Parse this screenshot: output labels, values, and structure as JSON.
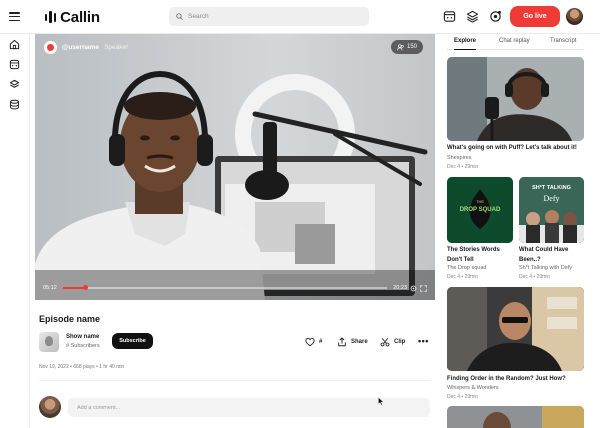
{
  "app": {
    "logo_text": "Callin"
  },
  "header": {
    "search_placeholder": "Search",
    "go_live_label": "Go live"
  },
  "video": {
    "username": "@username",
    "role": "Speaker",
    "listeners": "150",
    "current_time": "05:12",
    "total_time": "20:23",
    "progress_fraction": 0.07
  },
  "episode": {
    "title": "Episode name",
    "show_name": "Show name",
    "subscribers": "# Subscribers",
    "subscribe_label": "Subscribe",
    "likes": "#",
    "share_label": "Share",
    "clip_label": "Clip",
    "meta": "Nov 19, 2022 • 668 plays • 1 hr 40 min"
  },
  "comments": {
    "placeholder": "Add a comment..."
  },
  "sidebar": {
    "tabs": [
      {
        "label": "Explore",
        "active": true
      },
      {
        "label": "Chat replay",
        "active": false
      },
      {
        "label": "Transcript",
        "active": false
      }
    ],
    "cards": [
      {
        "title": "What's going on with Puff? Let's talk about it!",
        "show": "Shespires",
        "meta": "Dec 4 • 29min"
      },
      {
        "title": "The Stories Words Don't Tell",
        "show": "The Drop squad",
        "meta": "Dec 4 • 29min",
        "art_text_top": "THE",
        "art_text_main": "DROP SQUAD"
      },
      {
        "title": "What Could Have Been..?",
        "show": "Sh*t Talking with Defy",
        "meta": "Dec 4 • 29min",
        "art_text_top": "SH*T TALKING",
        "art_text_main": "Defy"
      },
      {
        "title": "Finding Order in the Random? Just How?",
        "show": "Whispers & Wonders",
        "meta": "Dec 4 • 29min"
      }
    ]
  },
  "colors": {
    "accent": "#ee3b36",
    "dark": "#111111"
  }
}
